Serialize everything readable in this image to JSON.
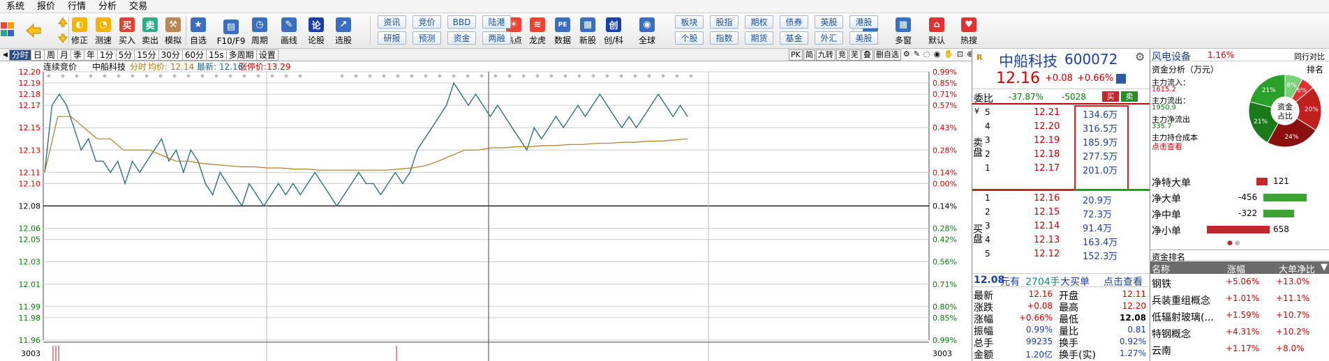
{
  "menu": [
    "系统",
    "报价",
    "行情",
    "分析",
    "交易"
  ],
  "toolbar": {
    "buttons": [
      "修正",
      "测速",
      "买入",
      "卖出",
      "模拟",
      "自选",
      "F10/F9",
      "周期",
      "画线",
      "论股",
      "选股",
      "热点",
      "龙虎",
      "数据",
      "新股",
      "创/科",
      "全球",
      "自定",
      "多窗",
      "默认",
      "热搜"
    ],
    "pills_row1": [
      "资讯",
      "竞价",
      "BBD",
      "陆港",
      "板块",
      "股指",
      "期权",
      "债券",
      "英股",
      "港股"
    ],
    "pills_row2": [
      "研报",
      "预测",
      "资金",
      "两融",
      "个股",
      "指数",
      "期货",
      "基金",
      "外汇",
      "美股"
    ]
  },
  "period_tabs": [
    "分时",
    "日",
    "周",
    "月",
    "季",
    "年",
    "1分",
    "5分",
    "15分",
    "30分",
    "60分",
    "15s",
    "多周期",
    "设置"
  ],
  "period_active": "分时",
  "right_tools": [
    "PK",
    "简",
    "九转",
    "竞",
    "芜",
    "叠",
    "删自选"
  ],
  "chart_header": {
    "label1": "连续竞价",
    "name": "中船科技",
    "mode": "分时",
    "avg": "均价: 12.14",
    "latest": "最新: 12.16",
    "limit_up": "涨停价:13.29"
  },
  "chart_data": {
    "type": "line",
    "y_ticks": [
      "12.20",
      "12.19",
      "12.18",
      "12.17",
      "12.15",
      "12.13",
      "12.11",
      "12.10",
      "12.08",
      "12.06",
      "12.05",
      "12.03",
      "12.01",
      "11.99",
      "11.98",
      "11.96"
    ],
    "pct_ticks": [
      "0.99%",
      "0.85%",
      "0.71%",
      "0.57%",
      "0.43%",
      "0.28%",
      "0.14%",
      "0.00%",
      "0.14%",
      "0.28%",
      "0.42%",
      "0.56%",
      "0.71%",
      "0.80%",
      "0.85%",
      "0.99%"
    ],
    "ylim": [
      11.96,
      12.2
    ],
    "vol_label": "3003",
    "series": [
      {
        "name": "最新",
        "values": [
          12.11,
          12.17,
          12.18,
          12.17,
          12.15,
          12.13,
          12.14,
          12.12,
          12.12,
          12.11,
          12.12,
          12.1,
          12.12,
          12.11,
          12.12,
          12.13,
          12.14,
          12.12,
          12.13,
          12.11,
          12.13,
          12.12,
          12.1,
          12.09,
          12.11,
          12.1,
          12.09,
          12.08,
          12.1,
          12.09,
          12.08,
          12.09,
          12.1,
          12.09,
          12.1,
          12.09,
          12.1,
          12.11,
          12.1,
          12.09,
          12.08,
          12.09,
          12.1,
          12.11,
          12.1,
          12.1,
          12.09,
          12.1,
          12.11,
          12.1,
          12.11,
          12.13,
          12.14,
          12.15,
          12.16,
          12.17,
          12.19,
          12.18,
          12.17,
          12.18,
          12.17,
          12.16,
          12.17,
          12.16,
          12.15,
          12.14,
          12.13,
          12.15,
          12.14,
          12.15,
          12.16,
          12.15,
          12.16,
          12.17,
          12.16,
          12.17,
          12.18,
          12.17,
          12.16,
          12.15,
          12.16,
          12.15,
          12.16,
          12.17,
          12.18,
          12.17,
          12.16,
          12.17,
          12.16
        ]
      },
      {
        "name": "均价",
        "values": [
          12.11,
          12.16,
          12.16,
          12.15,
          12.14,
          12.14,
          12.13,
          12.13,
          12.13,
          12.125,
          12.12,
          12.12,
          12.118,
          12.117,
          12.116,
          12.115,
          12.115,
          12.114,
          12.114,
          12.113,
          12.113,
          12.112,
          12.112,
          12.112,
          12.112,
          12.112,
          12.112,
          12.113,
          12.114,
          12.116,
          12.12,
          12.125,
          12.13,
          12.13,
          12.132,
          12.132,
          12.133,
          12.133,
          12.134,
          12.134,
          12.135,
          12.135,
          12.136,
          12.136,
          12.137,
          12.137,
          12.138,
          12.138,
          12.139,
          12.14
        ]
      }
    ]
  },
  "quote": {
    "name": "中船科技",
    "code": "600072",
    "price": "12.16",
    "change": "+0.08",
    "change_pct": "+0.66%",
    "weibi_label": "委比",
    "weibi": "-37.87%",
    "weicha": "-5028",
    "buy_btn": "买",
    "sell_btn": "卖",
    "sell_label": "卖盘",
    "buy_label": "买盘",
    "asks": [
      {
        "lvl": "5",
        "price": "12.21",
        "vol": "134.6万"
      },
      {
        "lvl": "4",
        "price": "12.20",
        "vol": "316.5万"
      },
      {
        "lvl": "3",
        "price": "12.19",
        "vol": "185.9万"
      },
      {
        "lvl": "2",
        "price": "12.18",
        "vol": "277.5万"
      },
      {
        "lvl": "1",
        "price": "12.17",
        "vol": "201.0万"
      }
    ],
    "bids": [
      {
        "lvl": "1",
        "price": "12.16",
        "vol": "20.9万"
      },
      {
        "lvl": "2",
        "price": "12.15",
        "vol": "72.3万"
      },
      {
        "lvl": "3",
        "price": "12.14",
        "vol": "91.4万"
      },
      {
        "lvl": "4",
        "price": "12.13",
        "vol": "163.4万"
      },
      {
        "lvl": "5",
        "price": "12.12",
        "vol": "152.3万"
      }
    ],
    "bigorder": {
      "price": "12.08",
      "unit": "元有",
      "hands": "2704手",
      "label": "大买单",
      "link": "点击查看"
    },
    "stats": [
      {
        "k1": "最新",
        "v1": "12.16",
        "k2": "开盘",
        "v2": "12.11"
      },
      {
        "k1": "涨跌",
        "v1": "+0.08",
        "k2": "最高",
        "v2": "12.20"
      },
      {
        "k1": "涨幅",
        "v1": "+0.66%",
        "k2": "最低",
        "v2": "12.08"
      },
      {
        "k1": "振幅",
        "v1": "0.99%",
        "k2": "量比",
        "v2": "0.81"
      },
      {
        "k1": "总手",
        "v1": "99235",
        "k2": "换手",
        "v2": "0.92%"
      },
      {
        "k1": "金额",
        "v1": "1.20亿",
        "k2": "换手(实)",
        "v2": "1.27%"
      }
    ]
  },
  "fund": {
    "sector": "风电设备",
    "sector_pct": "1.16%",
    "compare": "同行对比",
    "title": "资金分析（万元）",
    "rank_link": "排名",
    "inflow_label": "主力流入：",
    "inflow": "1615.2",
    "outflow_label": "主力流出：",
    "outflow": "1950.9",
    "net_label": "主力净流出",
    "net": "335.7",
    "cost_label": "主力持仓成本",
    "cost_link": "点击查看",
    "donut_center": "资金\n占比",
    "donut_pcts": [
      "8%",
      "6%",
      "20%",
      "24%",
      "21%",
      "21%"
    ],
    "flows": [
      {
        "label": "净特大单",
        "value": "121",
        "color": "#c0282d",
        "ratio": 0.18
      },
      {
        "label": "净大单",
        "value": "-456",
        "color": "#3aa332",
        "ratio": 0.69
      },
      {
        "label": "净中单",
        "value": "-322",
        "color": "#3aa332",
        "ratio": 0.49
      },
      {
        "label": "净小单",
        "value": "658",
        "color": "#c0282d",
        "ratio": 1.0
      }
    ],
    "rank_title": "资金排名",
    "rank_headers": [
      "名称",
      "涨幅",
      "大单净比"
    ],
    "rank_rows": [
      {
        "name": "钢铁",
        "pct": "+5.06%",
        "net": "+13.0%"
      },
      {
        "name": "兵装重组概念",
        "pct": "+1.01%",
        "net": "+11.1%"
      },
      {
        "name": "低辐射玻璃(...",
        "pct": "+1.59%",
        "net": "+10.7%"
      },
      {
        "name": "特钢概念",
        "pct": "+4.31%",
        "net": "+10.2%"
      },
      {
        "name": "云南",
        "pct": "+1.17%",
        "net": "+8.0%"
      }
    ]
  }
}
